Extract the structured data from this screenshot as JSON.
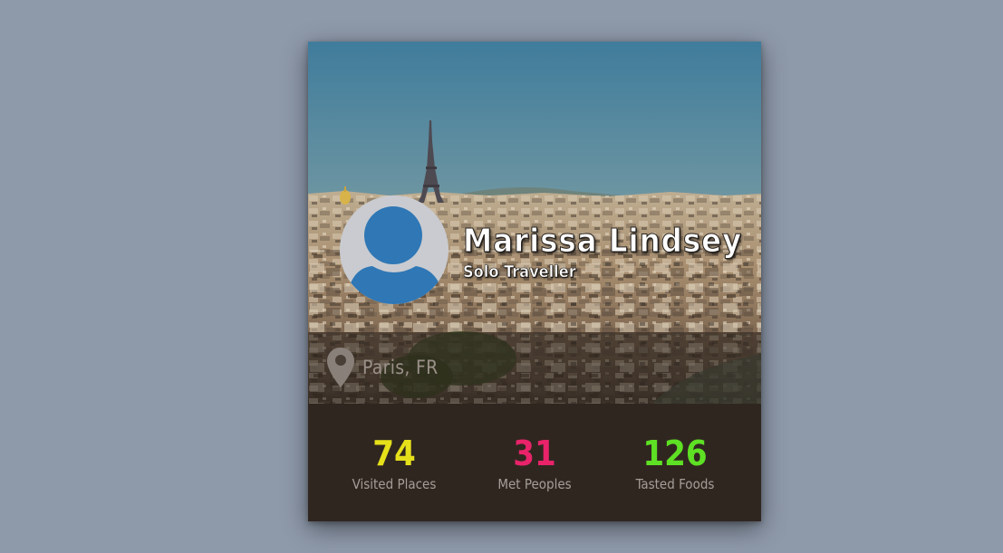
{
  "profile": {
    "name": "Marissa Lindsey",
    "subtitle": "Solo Traveller",
    "location": "Paris, FR"
  },
  "stats": [
    {
      "value": "74",
      "label": "Visited Places",
      "color": "#e6e01a"
    },
    {
      "value": "31",
      "label": "Met Peoples",
      "color": "#e8236a"
    },
    {
      "value": "126",
      "label": "Tasted Foods",
      "color": "#5ee024"
    }
  ],
  "icons": {
    "location": "map-pin-icon",
    "avatar": "user-silhouette-icon"
  },
  "colors": {
    "page_background": "#8e99aa",
    "card_background": "#302620",
    "avatar_blue": "#2f77b5"
  }
}
